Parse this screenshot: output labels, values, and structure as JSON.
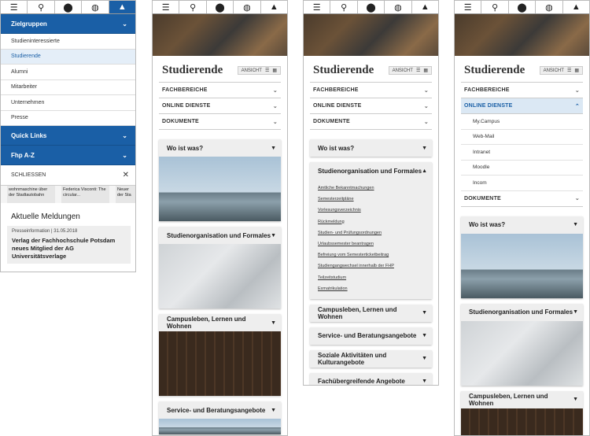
{
  "topbar_icons": [
    "menu-icon",
    "search-icon",
    "location-pin-icon",
    "globe-icon",
    "graduation-cap-icon"
  ],
  "menu": {
    "zielgruppen": "Zielgruppen",
    "items": [
      "Studieninteressierte",
      "Studierende",
      "Alumni",
      "Mitarbeiter",
      "Unternehmen",
      "Presse"
    ],
    "quick_links": "Quick Links",
    "fhp_az": "Fhp A-Z",
    "close": "SCHLIESSEN",
    "teasers": [
      "wohnmaschine über der Stadtautobahn",
      "Federica Visconti: The circular...",
      "Neuer der Sta"
    ],
    "news_heading": "Aktuelle Meldungen",
    "news_meta": "Presseinformation | 31.05.2018",
    "news_title": "Verlag der Fachhochschule Potsdam neues Mitglied der AG Universitätsverlage"
  },
  "page": {
    "title": "Studierende",
    "ansicht": "ANSICHT",
    "acc": [
      "FACHBEREICHE",
      "ONLINE DIENSTE",
      "DOKUMENTE"
    ],
    "cards": [
      "Wo ist was?",
      "Studienorganisation und Formales",
      "Campusleben, Lernen und Wohnen",
      "Service- und Beratungsangebote",
      "Soziale Aktivitäten und Kulturangebote",
      "Fachübergreifende Angebote"
    ],
    "sub_links": [
      "Amtliche Bekanntmachungen",
      "Semesterzeitpläne",
      "Vorlesungsverzeichnis",
      "Rückmeldung",
      "Studien- und Prüfungsordnungen",
      "Urlaubssemester beantragen",
      "Befreiung vom Semesterticketbeitrag",
      "Studiengangwechsel innerhalb der FHP",
      "Teilzeitstudium",
      "Exmatrikulation"
    ],
    "online_items": [
      "My.Campus",
      "Web-Mail",
      "Intranet",
      "Moodle",
      "Incom"
    ]
  }
}
